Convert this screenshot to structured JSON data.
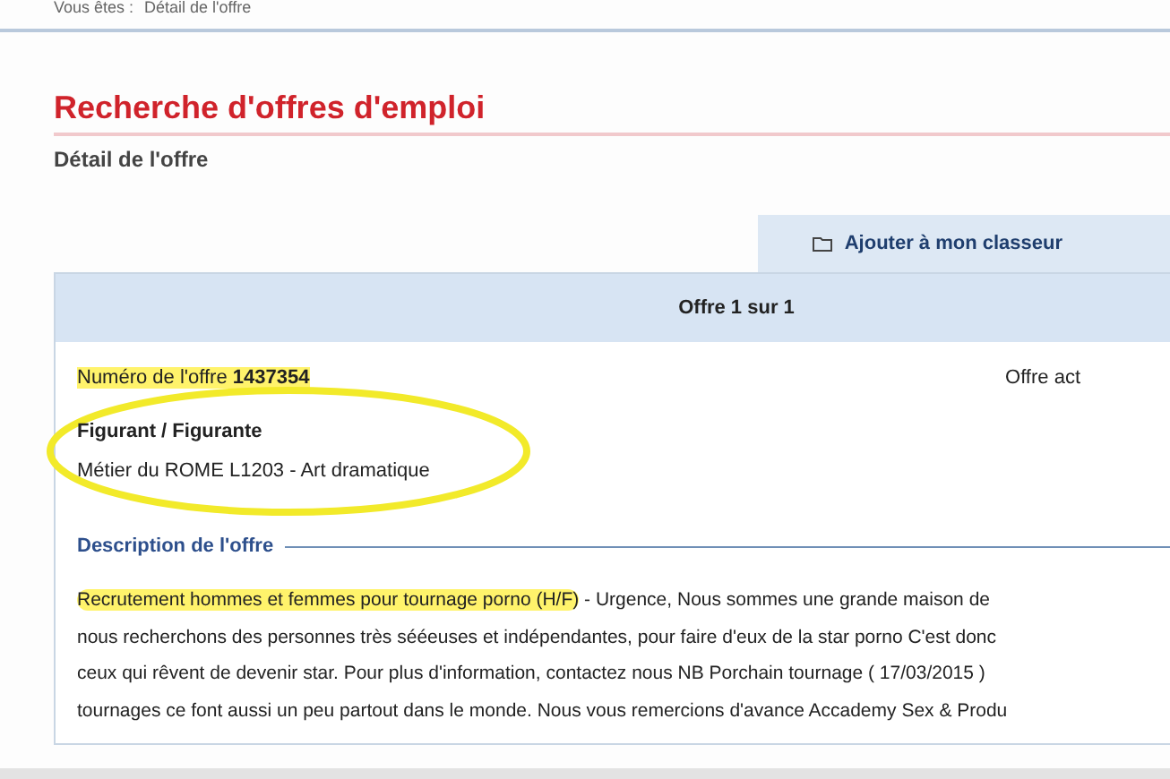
{
  "breadcrumb": {
    "label": "Vous êtes :",
    "current": "Détail de l'offre"
  },
  "page_title": "Recherche d'offres d'emploi",
  "subtitle": "Détail de l'offre",
  "add_button": {
    "label": "Ajouter à mon classeur"
  },
  "offer": {
    "header": "Offre 1 sur 1",
    "number_label": "Numéro de l'offre",
    "number": "1437354",
    "number_highlighted": true,
    "status": "Offre act",
    "title": "Figurant / Figurante",
    "rome": "Métier du ROME L1203 - Art dramatique",
    "circled": true,
    "description_heading": "Description de l'offre",
    "description_lead": "Recrutement hommes et femmes pour tournage porno (H/F)",
    "lead_highlighted": true,
    "description_lines": [
      "- Urgence, Nous sommes une grande maison de",
      "nous recherchons des personnes très sééeuses et indépendantes, pour faire d'eux de la star porno C'est donc",
      "ceux qui rêvent de devenir star. Pour plus d'information, contactez nous NB Porchain tournage ( 17/03/2015 )",
      "tournages ce font aussi un peu partout dans le monde. Nous vous remercions d'avance Accademy Sex & Produ"
    ]
  }
}
